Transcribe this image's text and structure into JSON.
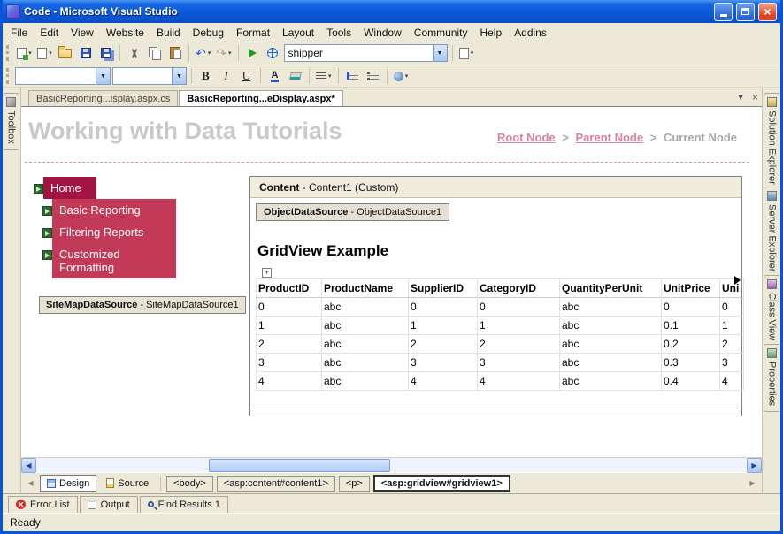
{
  "colors": {
    "titlebar_blue": "#0b58d8",
    "window_border": "#0855dd",
    "chrome_beige": "#ece9d8",
    "nav_home_bg": "#a21441",
    "nav_item_bg": "#c23a57",
    "nav_arrow_green": "#2d6a2d",
    "breadcrumb_link_pink": "#dd8398",
    "page_title_gray": "#c9c9c9"
  },
  "window": {
    "title": "Code - Microsoft Visual Studio"
  },
  "menus": [
    "File",
    "Edit",
    "View",
    "Website",
    "Build",
    "Debug",
    "Format",
    "Layout",
    "Tools",
    "Window",
    "Community",
    "Help",
    "Addins"
  ],
  "toolbar": {
    "combo_value": "shipper"
  },
  "side_tabs": {
    "left": [
      "Toolbox"
    ],
    "right": [
      "Solution Explorer",
      "Server Explorer",
      "Class View",
      "Properties"
    ]
  },
  "doc_tabs": [
    "BasicReporting...isplay.aspx.cs",
    "BasicReporting...eDisplay.aspx*"
  ],
  "design": {
    "page_title": "Working with Data Tutorials",
    "breadcrumb": {
      "root": "Root Node",
      "parent": "Parent Node",
      "current": "Current Node",
      "sep": ">"
    },
    "menu_items": [
      "Home",
      "Basic Reporting",
      "Filtering Reports",
      "Customized Formatting"
    ],
    "sitemap": {
      "name": "SiteMapDataSource",
      "rest": " - SiteMapDataSource1"
    },
    "content_header": {
      "name": "Content",
      "rest": " - Content1 (Custom)"
    },
    "ods": {
      "name": "ObjectDataSource",
      "rest": " - ObjectDataSource1"
    },
    "grid_title": "GridView Example",
    "anchor_glyph": "+",
    "table": {
      "headers": [
        "ProductID",
        "ProductName",
        "SupplierID",
        "CategoryID",
        "QuantityPerUnit",
        "UnitPrice",
        "Uni"
      ],
      "rows": [
        [
          "0",
          "abc",
          "0",
          "0",
          "abc",
          "0",
          "0"
        ],
        [
          "1",
          "abc",
          "1",
          "1",
          "abc",
          "0.1",
          "1"
        ],
        [
          "2",
          "abc",
          "2",
          "2",
          "abc",
          "0.2",
          "2"
        ],
        [
          "3",
          "abc",
          "3",
          "3",
          "abc",
          "0.3",
          "3"
        ],
        [
          "4",
          "abc",
          "4",
          "4",
          "abc",
          "0.4",
          "4"
        ]
      ]
    }
  },
  "bottom": {
    "view_tabs": [
      "Design",
      "Source"
    ],
    "tag_path": [
      "<body>",
      "<asp:content#content1>",
      "<p>",
      "<asp:gridview#gridview1>"
    ],
    "panel_tabs": [
      "Error List",
      "Output",
      "Find Results 1"
    ],
    "status": "Ready"
  }
}
